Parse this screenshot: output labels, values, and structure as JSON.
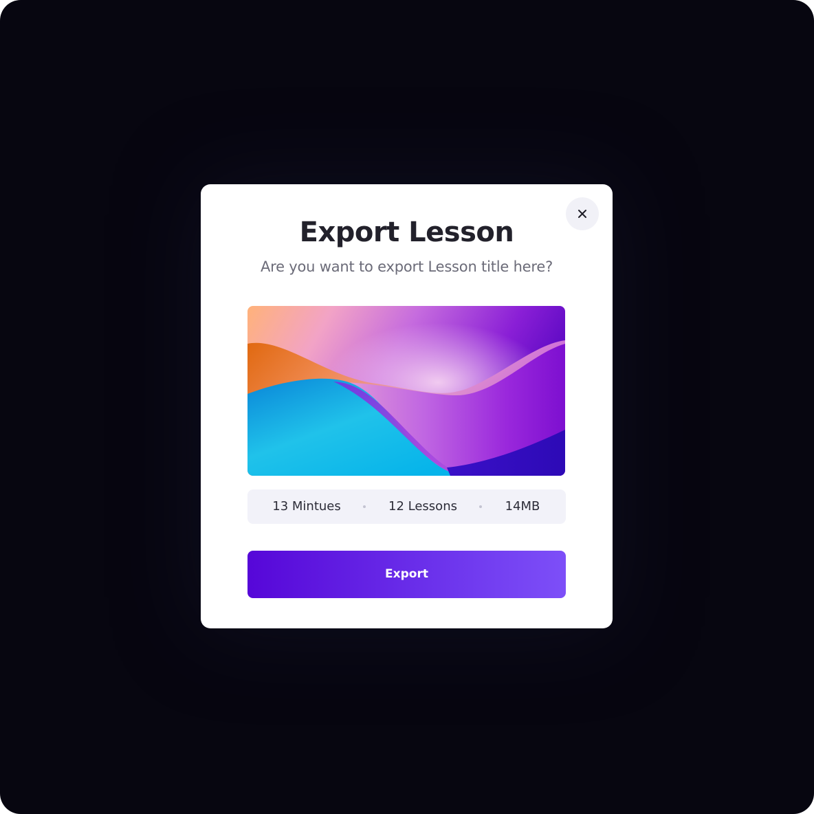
{
  "dialog": {
    "title": "Export Lesson",
    "subtitle": "Are you want to export Lesson title here?",
    "close_icon": "close-icon",
    "meta": {
      "duration": "13 Mintues",
      "lessons": "12 Lessons",
      "size": "14MB"
    },
    "export_label": "Export"
  },
  "colors": {
    "background": "#070610",
    "primary": "#5607d8",
    "primary_end": "#7d4ff8",
    "meta_bg": "#f2f2f9"
  }
}
